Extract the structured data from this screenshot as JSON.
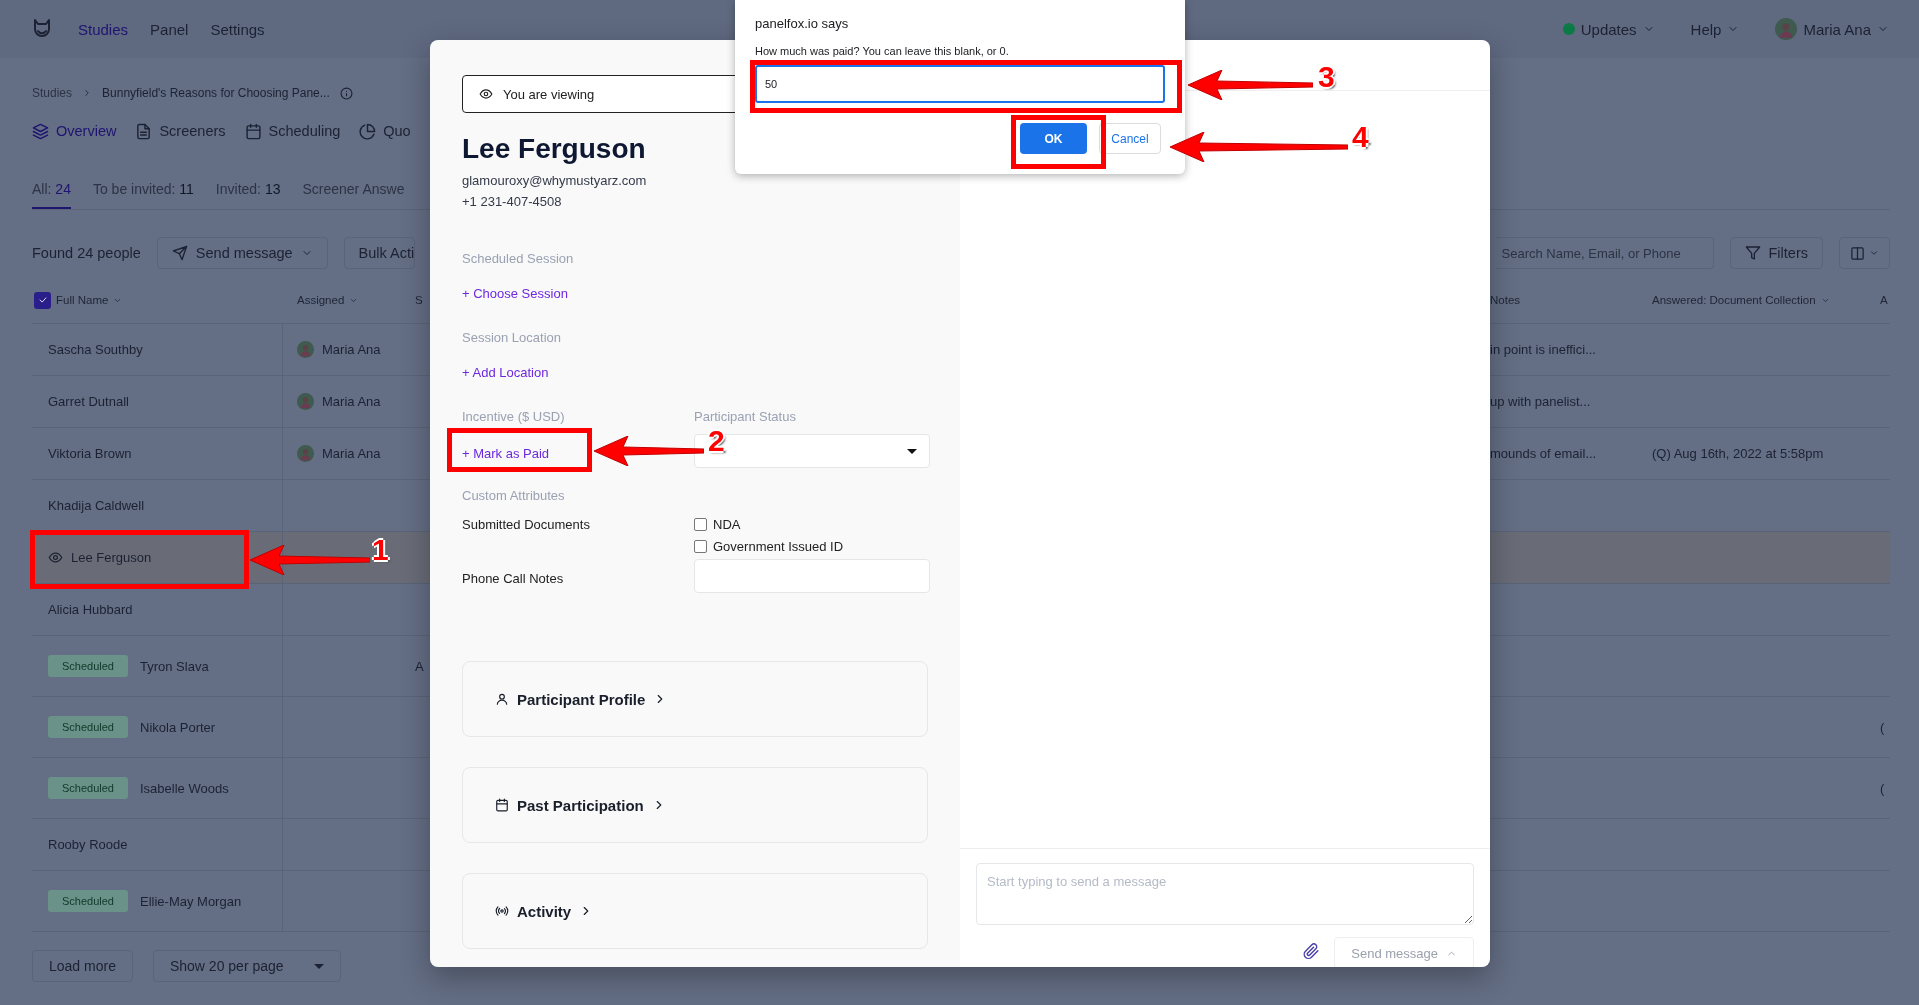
{
  "header": {
    "nav": [
      {
        "label": "Studies",
        "selected": true
      },
      {
        "label": "Panel",
        "selected": false
      },
      {
        "label": "Settings",
        "selected": false
      }
    ],
    "updates": "Updates",
    "help": "Help",
    "user": "Maria Ana"
  },
  "breadcrumb": [
    "Studies",
    "Bunnyfield's Reasons for Choosing Pane..."
  ],
  "tabs": [
    {
      "label": "Overview",
      "selected": true
    },
    {
      "label": "Screeners",
      "selected": false
    },
    {
      "label": "Scheduling",
      "selected": false
    },
    {
      "label": "Quo",
      "selected": false
    }
  ],
  "filters": [
    {
      "label": "All:",
      "count": "24",
      "selected": true
    },
    {
      "label": "To be invited:",
      "count": "11",
      "selected": false
    },
    {
      "label": "Invited:",
      "count": "13",
      "selected": false
    },
    {
      "label": "Screener Answe",
      "selected": false
    }
  ],
  "toolbar": {
    "found": "Found 24 people",
    "send": "Send message",
    "bulk": "Bulk Acti",
    "search_placeholder": "Search Name, Email, or Phone",
    "filters": "Filters"
  },
  "table": {
    "select_all_checked": true,
    "columns": [
      "Full Name",
      "Assigned",
      "S",
      "Notes",
      "Answered: Document Collection",
      "A"
    ],
    "rows": [
      {
        "name": "Sascha Southby",
        "selected": false,
        "assigned": "Maria Ana",
        "notes": "in point is ineffici..."
      },
      {
        "name": "Garret Dutnall",
        "selected": false,
        "assigned": "Maria Ana",
        "notes": "up with panelist..."
      },
      {
        "name": "Viktoria Brown",
        "selected": false,
        "assigned": "Maria Ana",
        "notes": "mounds of email...",
        "answered": "(Q) Aug 16th, 2022 at 5:58pm"
      },
      {
        "name": "Khadija Caldwell",
        "selected": false
      },
      {
        "name": "Lee Ferguson",
        "selected": true
      },
      {
        "name": "Alicia Hubbard",
        "selected": false
      },
      {
        "name": "Tyron Slava",
        "selected": false,
        "status": "Scheduled",
        "column_3": "A"
      },
      {
        "name": "Nikola Porter",
        "selected": false,
        "status": "Scheduled",
        "column_6": "("
      },
      {
        "name": "Isabelle Woods",
        "selected": false,
        "status": "Scheduled",
        "column_6": "("
      },
      {
        "name": "Rooby Roode",
        "selected": false
      },
      {
        "name": "Ellie-May Morgan",
        "selected": false,
        "status": "Scheduled"
      }
    ]
  },
  "pagination": {
    "load_more": "Load more",
    "page_size": "Show 20 per page"
  },
  "profile": {
    "viewing": "You are viewing",
    "name": "Lee Ferguson",
    "email": "glamouroxy@whymustyarz.com",
    "phone": "+1 231-407-4508",
    "scheduled_label": "Scheduled Session",
    "scheduled_action": "+ Choose Session",
    "location_label": "Session Location",
    "location_action": "+ Add Location",
    "incentive_label": "Incentive ($ USD)",
    "incentive_action": "+ Mark as Paid",
    "status_label": "Participant Status",
    "custom_label": "Custom Attributes",
    "documents_label": "Submitted Documents",
    "documents": [
      {
        "label": "NDA",
        "checked": false
      },
      {
        "label": "Government Issued ID",
        "checked": false
      }
    ],
    "notes_label": "Phone Call Notes",
    "sections": [
      "Participant Profile",
      "Past Participation",
      "Activity"
    ]
  },
  "composer": {
    "placeholder": "Start typing to send a message",
    "send": "Send message"
  },
  "prompt": {
    "title": "panelfox.io says",
    "message": "How much was paid? You can leave this blank, or 0.",
    "value": "50",
    "ok": "OK",
    "cancel": "Cancel"
  },
  "annotations": [
    {
      "label": "1"
    },
    {
      "label": "2"
    },
    {
      "label": "3"
    },
    {
      "label": "4"
    }
  ]
}
